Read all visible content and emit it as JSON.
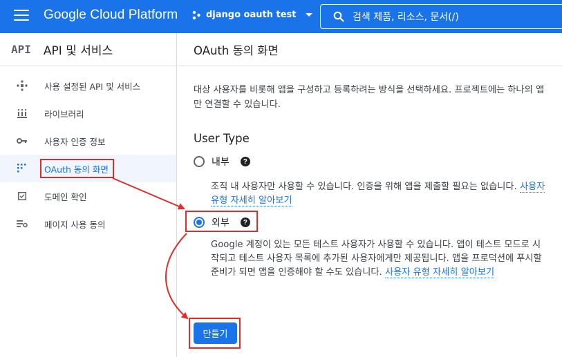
{
  "topbar": {
    "brand": "Google Cloud Platform",
    "project_name": "django oauth test",
    "search_text": "검색   제품, 리소스, 문서(/)"
  },
  "sidebar": {
    "logo": "API",
    "title": "API 및 서비스",
    "items": [
      {
        "label": "사용 설정된 API 및 서비스",
        "icon": "diamond-dots-icon",
        "active": false
      },
      {
        "label": "라이브러리",
        "icon": "library-icon",
        "active": false
      },
      {
        "label": "사용자 인증 정보",
        "icon": "key-icon",
        "active": false
      },
      {
        "label": "OAuth 동의 화면",
        "icon": "oauth-consent-icon",
        "active": true
      },
      {
        "label": "도메인 확인",
        "icon": "domain-check-icon",
        "active": false
      },
      {
        "label": "페이지 사용 동의",
        "icon": "page-settings-icon",
        "active": false
      }
    ]
  },
  "main": {
    "title": "OAuth 동의 화면",
    "description": "대상 사용자를 비롯해 앱을 구성하고 등록하려는 방식을 선택하세요. 프로젝트에는 하나의 앱만 연결할 수 있습니다.",
    "user_type_title": "User Type",
    "internal": {
      "label": "내부",
      "desc": "조직 내 사용자만 사용할 수 있습니다. 인증을 위해 앱을 제출할 필요는 없습니다.",
      "learn_more": "사용자 유형 자세히 알아보기",
      "selected": false
    },
    "external": {
      "label": "외부",
      "desc": "Google 계정이 있는 모든 테스트 사용자가 사용할 수 있습니다. 앱이 테스트 모드로 시작되고 테스트 사용자 목록에 추가된 사용자에게만 제공됩니다. 앱을 프로덕션에 푸시할 준비가 되면 앱을 인증해야 할 수도 있습니다.",
      "learn_more": "사용자 유형 자세히 알아보기",
      "selected": true
    },
    "create_button": "만들기"
  },
  "colors": {
    "primary": "#1a73e8",
    "annotation": "#e32b2b"
  }
}
